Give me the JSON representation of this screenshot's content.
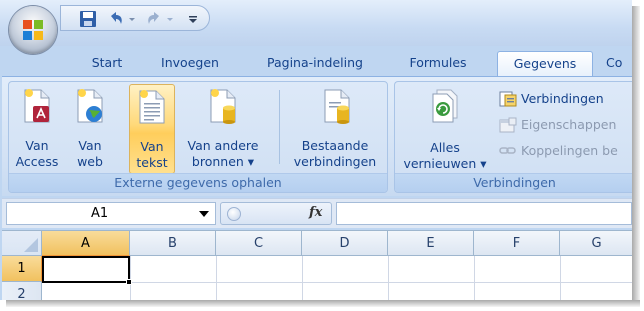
{
  "qat": {
    "icons": [
      "save-icon",
      "undo-icon",
      "redo-icon",
      "customize-qat-icon"
    ]
  },
  "tabs": [
    {
      "label": "Start"
    },
    {
      "label": "Invoegen"
    },
    {
      "label": "Pagina-indeling"
    },
    {
      "label": "Formules"
    },
    {
      "label": "Gegevens",
      "active": true
    },
    {
      "label": "Co"
    }
  ],
  "ribbon": {
    "external_data_group": {
      "label": "Externe gegevens ophalen",
      "buttons": [
        {
          "line1": "Van",
          "line2": "Access",
          "icon": "access-db-icon"
        },
        {
          "line1": "Van",
          "line2": "web",
          "icon": "web-globe-icon"
        },
        {
          "line1": "Van",
          "line2": "tekst",
          "icon": "text-file-icon",
          "highlighted": true
        },
        {
          "line1": "Van andere",
          "line2": "bronnen ▾",
          "icon": "other-sources-icon"
        },
        {
          "line1": "Bestaande",
          "line2": "verbindingen",
          "icon": "existing-connections-icon"
        }
      ]
    },
    "connections_group": {
      "label": "Verbindingen",
      "refresh": {
        "line1": "Alles",
        "line2": "vernieuwen ▾",
        "icon": "refresh-all-icon"
      },
      "small_buttons": [
        {
          "label": "Verbindingen",
          "icon": "connections-icon",
          "enabled": true
        },
        {
          "label": "Eigenschappen",
          "icon": "properties-icon",
          "enabled": false
        },
        {
          "label": "Koppelingen be",
          "icon": "edit-links-icon",
          "enabled": false
        }
      ]
    }
  },
  "formula_bar": {
    "name_box": "A1",
    "fx_label": "fx",
    "formula": ""
  },
  "grid": {
    "columns": [
      "A",
      "B",
      "C",
      "D",
      "E",
      "F",
      "G"
    ],
    "rows": [
      "1",
      "2"
    ],
    "selected_cell": "A1"
  },
  "colors": {
    "ribbon_bg": "#d2e1f4",
    "highlight": "#ffd97a",
    "text": "#15428b"
  }
}
